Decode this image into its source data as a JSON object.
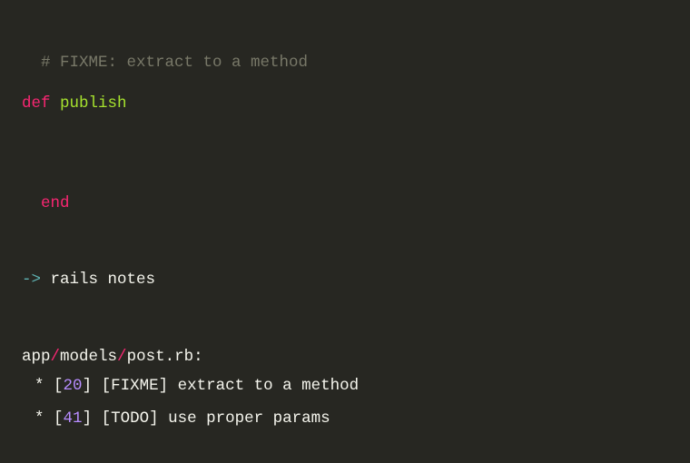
{
  "code": {
    "comment": "# FIXME: extract to a method",
    "def_keyword": "def",
    "method_name": "publish",
    "end_keyword": "end"
  },
  "terminal": {
    "arrow": "->",
    "command": "rails notes"
  },
  "output": {
    "path": {
      "seg1": "app",
      "seg2": "models",
      "seg3": "post.rb",
      "sep": "/",
      "colon": ":"
    },
    "notes": [
      {
        "bullet": "*",
        "lb": "[",
        "rb": "]",
        "line": "20",
        "tag": "FIXME",
        "msg": "extract to a method"
      },
      {
        "bullet": "*",
        "lb": "[",
        "rb": "]",
        "line": "41",
        "tag": "TODO",
        "msg": "use proper params"
      }
    ]
  }
}
